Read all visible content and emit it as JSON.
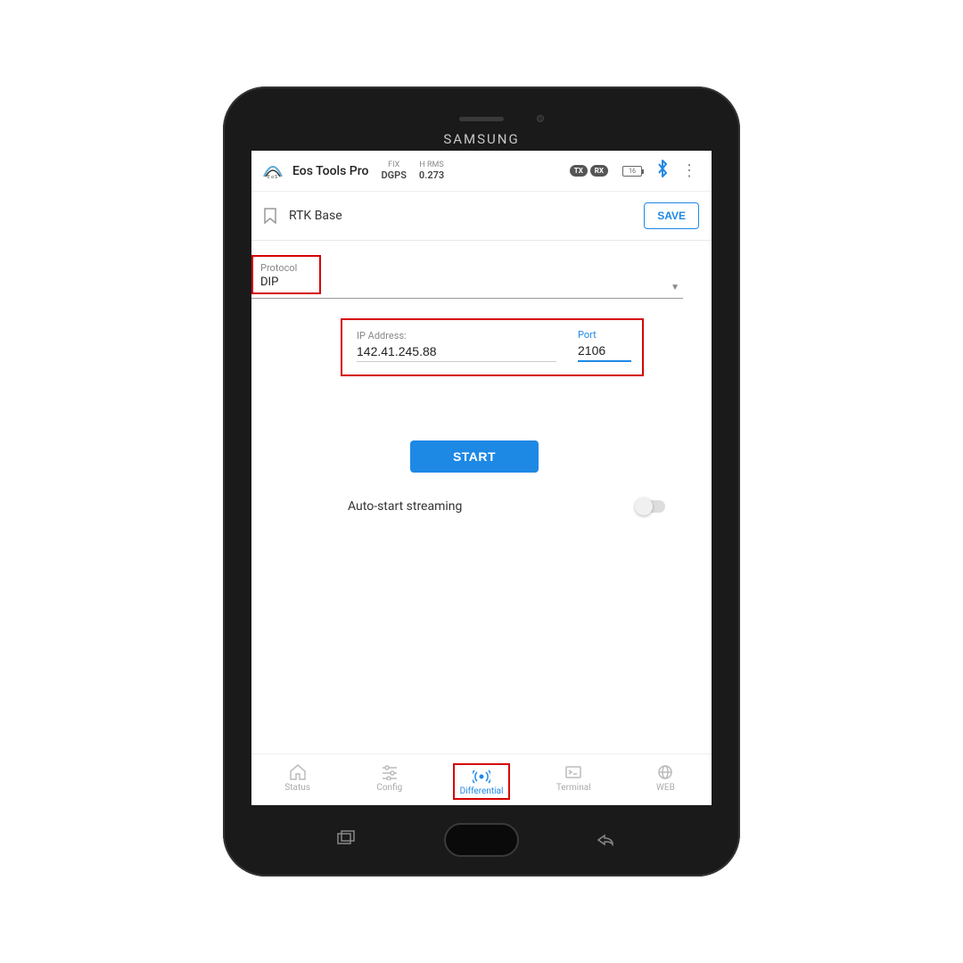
{
  "device_brand": "SAMSUNG",
  "header": {
    "app_title": "Eos Tools Pro",
    "fix_label": "FIX",
    "fix_value": "DGPS",
    "hrms_label": "H RMS",
    "hrms_value": "0.273",
    "tx_badge": "TX",
    "rx_badge": "RX",
    "battery_value": "16"
  },
  "subbar": {
    "title": "RTK Base",
    "save_label": "SAVE"
  },
  "form": {
    "protocol_label": "Protocol",
    "protocol_value": "DIP",
    "ip_label": "IP Address:",
    "ip_value": "142.41.245.88",
    "port_label": "Port",
    "port_value": "2106",
    "start_label": "START",
    "autostart_label": "Auto-start streaming"
  },
  "bottom_nav": {
    "items": [
      {
        "label": "Status"
      },
      {
        "label": "Config"
      },
      {
        "label": "Differential"
      },
      {
        "label": "Terminal"
      },
      {
        "label": "WEB"
      }
    ],
    "active_index": 2
  }
}
